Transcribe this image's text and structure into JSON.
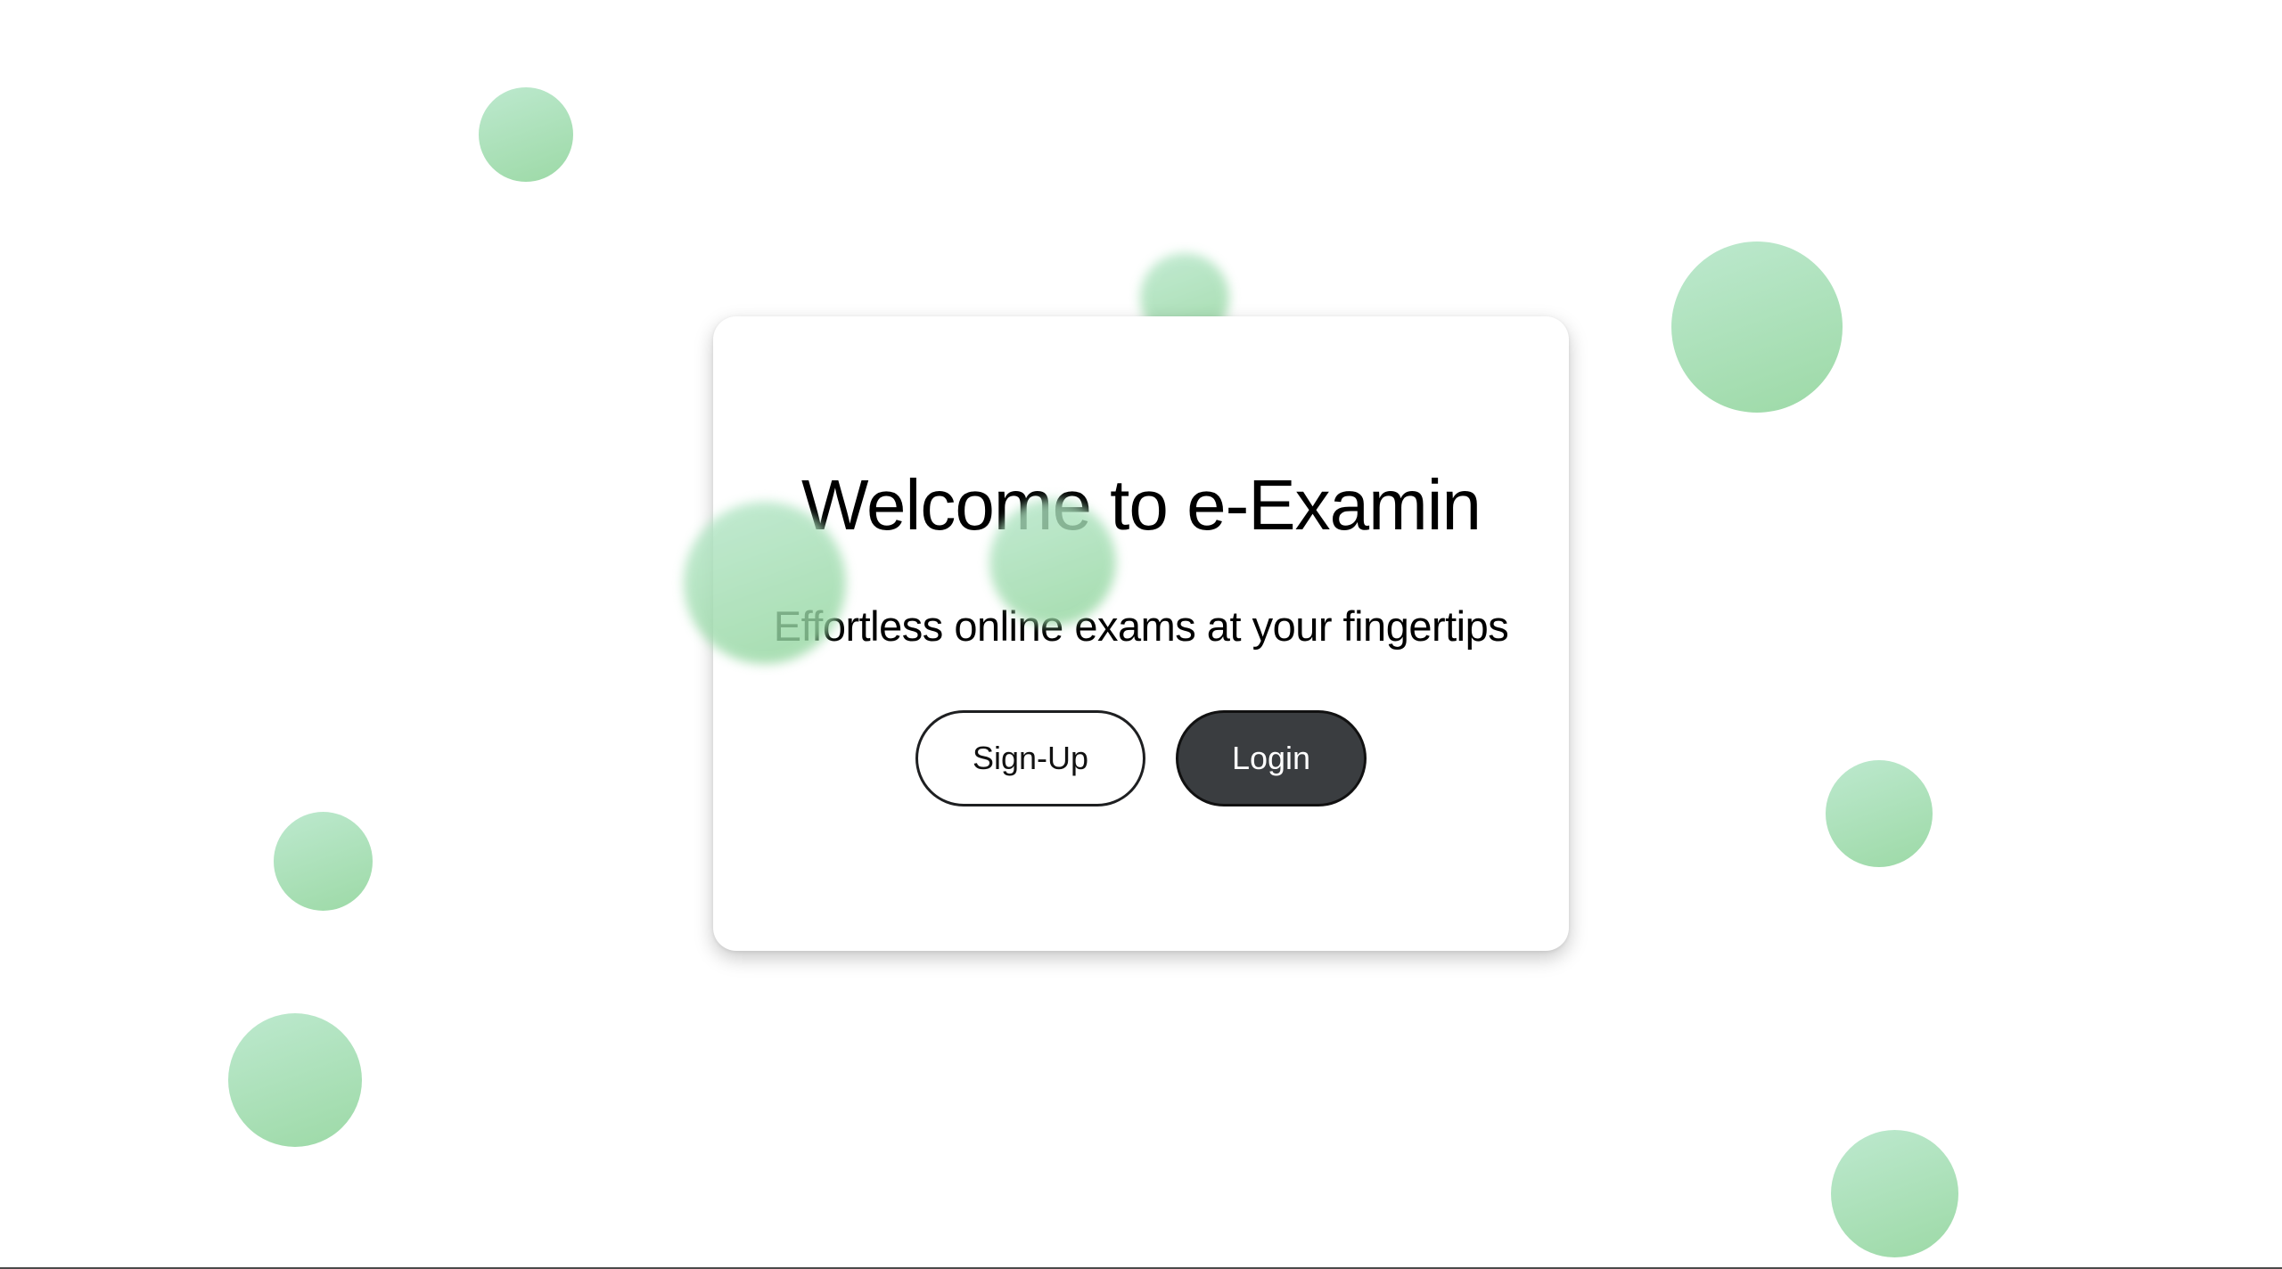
{
  "hero": {
    "title": "Welcome to e-Examin",
    "subtitle": "Effortless online exams at your fingertips"
  },
  "actions": {
    "signup_label": "Sign-Up",
    "login_label": "Login"
  },
  "colors": {
    "bubble_light": "#b4e6c8",
    "bubble_dark": "#8fd49a",
    "login_background": "#3a3d40",
    "card_background": "#ffffff"
  }
}
